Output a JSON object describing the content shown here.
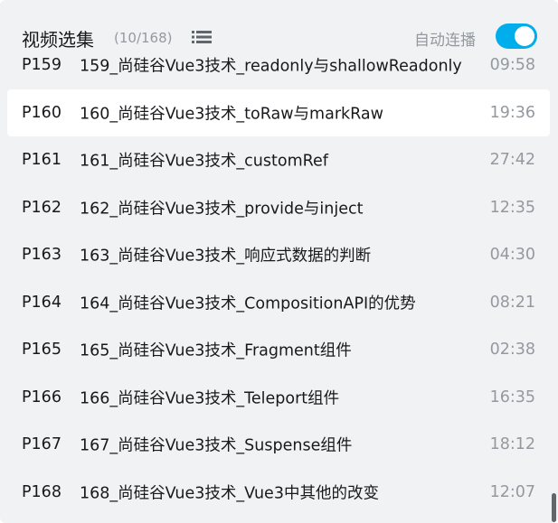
{
  "header": {
    "title": "视频选集",
    "count": "(10/168)",
    "list_icon": "list-icon",
    "autoplay_label": "自动连播",
    "autoplay_enabled": true
  },
  "colors": {
    "accent": "#00aeec",
    "muted": "#9499a0",
    "text": "#18191c",
    "panel_bg": "#f1f2f3",
    "active_bg": "#ffffff"
  },
  "episodes": [
    {
      "ep": "P159",
      "title": "159_尚硅谷Vue3技术_readonly与shallowReadonly",
      "duration": "09:58",
      "active": false
    },
    {
      "ep": "P160",
      "title": "160_尚硅谷Vue3技术_toRaw与markRaw",
      "duration": "19:36",
      "active": true
    },
    {
      "ep": "P161",
      "title": "161_尚硅谷Vue3技术_customRef",
      "duration": "27:42",
      "active": false
    },
    {
      "ep": "P162",
      "title": "162_尚硅谷Vue3技术_provide与inject",
      "duration": "12:35",
      "active": false
    },
    {
      "ep": "P163",
      "title": "163_尚硅谷Vue3技术_响应式数据的判断",
      "duration": "04:30",
      "active": false
    },
    {
      "ep": "P164",
      "title": "164_尚硅谷Vue3技术_CompositionAPI的优势",
      "duration": "08:21",
      "active": false
    },
    {
      "ep": "P165",
      "title": "165_尚硅谷Vue3技术_Fragment组件",
      "duration": "02:38",
      "active": false
    },
    {
      "ep": "P166",
      "title": "166_尚硅谷Vue3技术_Teleport组件",
      "duration": "16:35",
      "active": false
    },
    {
      "ep": "P167",
      "title": "167_尚硅谷Vue3技术_Suspense组件",
      "duration": "18:12",
      "active": false
    },
    {
      "ep": "P168",
      "title": "168_尚硅谷Vue3技术_Vue3中其他的改变",
      "duration": "12:07",
      "active": false
    }
  ]
}
